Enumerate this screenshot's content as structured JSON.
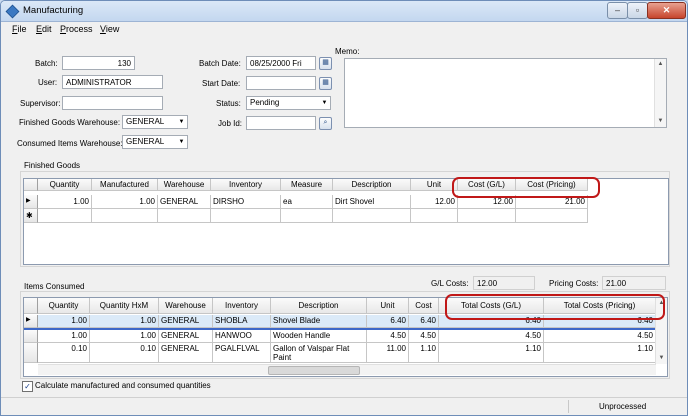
{
  "window": {
    "title": "Manufacturing"
  },
  "title_buttons": {
    "minimize": "–",
    "maximize": "▫",
    "close": "✕"
  },
  "menu": [
    {
      "hot": "F",
      "rest": "ile"
    },
    {
      "hot": "E",
      "rest": "dit"
    },
    {
      "hot": "P",
      "rest": "rocess"
    },
    {
      "hot": "V",
      "rest": "iew"
    }
  ],
  "form": {
    "batch_label": "Batch:",
    "batch_value": "130",
    "user_label": "User:",
    "user_value": "ADMINISTRATOR",
    "supervisor_label": "Supervisor:",
    "supervisor_value": "",
    "fg_warehouse_label": "Finished Goods Warehouse:",
    "fg_warehouse_value": "GENERAL",
    "ci_warehouse_label": "Consumed Items Warehouse:",
    "ci_warehouse_value": "GENERAL",
    "batch_date_label": "Batch Date:",
    "batch_date_value": "08/25/2000 Fri",
    "start_date_label": "Start Date:",
    "start_date_value": "",
    "status_label": "Status:",
    "status_value": "Pending",
    "job_id_label": "Job Id:",
    "job_id_value": "",
    "memo_label": "Memo:"
  },
  "finished_goods": {
    "section_label": "Finished Goods",
    "columns": [
      "Quantity",
      "Manufactured",
      "Warehouse",
      "Inventory",
      "Measure",
      "Description",
      "Unit",
      "Cost (G/L)",
      "Cost (Pricing)"
    ],
    "rows": [
      [
        "1.00",
        "1.00",
        "GENERAL",
        "DIRSHO",
        "ea",
        "Dirt Shovel",
        "12.00",
        "12.00",
        "21.00"
      ]
    ],
    "row_markers": [
      "▶",
      "✱"
    ]
  },
  "items_consumed": {
    "section_label": "Items Consumed",
    "gl_costs_label": "G/L Costs:",
    "gl_costs_value": "12.00",
    "pricing_costs_label": "Pricing Costs:",
    "pricing_costs_value": "21.00",
    "columns": [
      "Quantity",
      "Quantity HxM",
      "Warehouse",
      "Inventory",
      "Description",
      "Unit",
      "Cost",
      "Total Costs (G/L)",
      "Total Costs (Pricing)"
    ],
    "rows": [
      [
        "1.00",
        "1.00",
        "GENERAL",
        "SHOBLA",
        "Shovel Blade",
        "6.40",
        "6.40",
        "6.40",
        "6.40"
      ],
      [
        "1.00",
        "1.00",
        "GENERAL",
        "HANWOO",
        "Wooden Handle",
        "4.50",
        "4.50",
        "4.50",
        "4.50"
      ],
      [
        "0.10",
        "0.10",
        "GENERAL",
        "PGALFLVAL",
        "Gallon of Valspar Flat",
        "11.00",
        "1.10",
        "1.10",
        "1.10"
      ]
    ],
    "row3_description_line2": "Paint",
    "row_marker": "▶"
  },
  "options": {
    "calculate_label": "Calculate manufactured and consumed quantities",
    "calculate_checked": true
  },
  "status": {
    "text": "Unprocessed"
  }
}
